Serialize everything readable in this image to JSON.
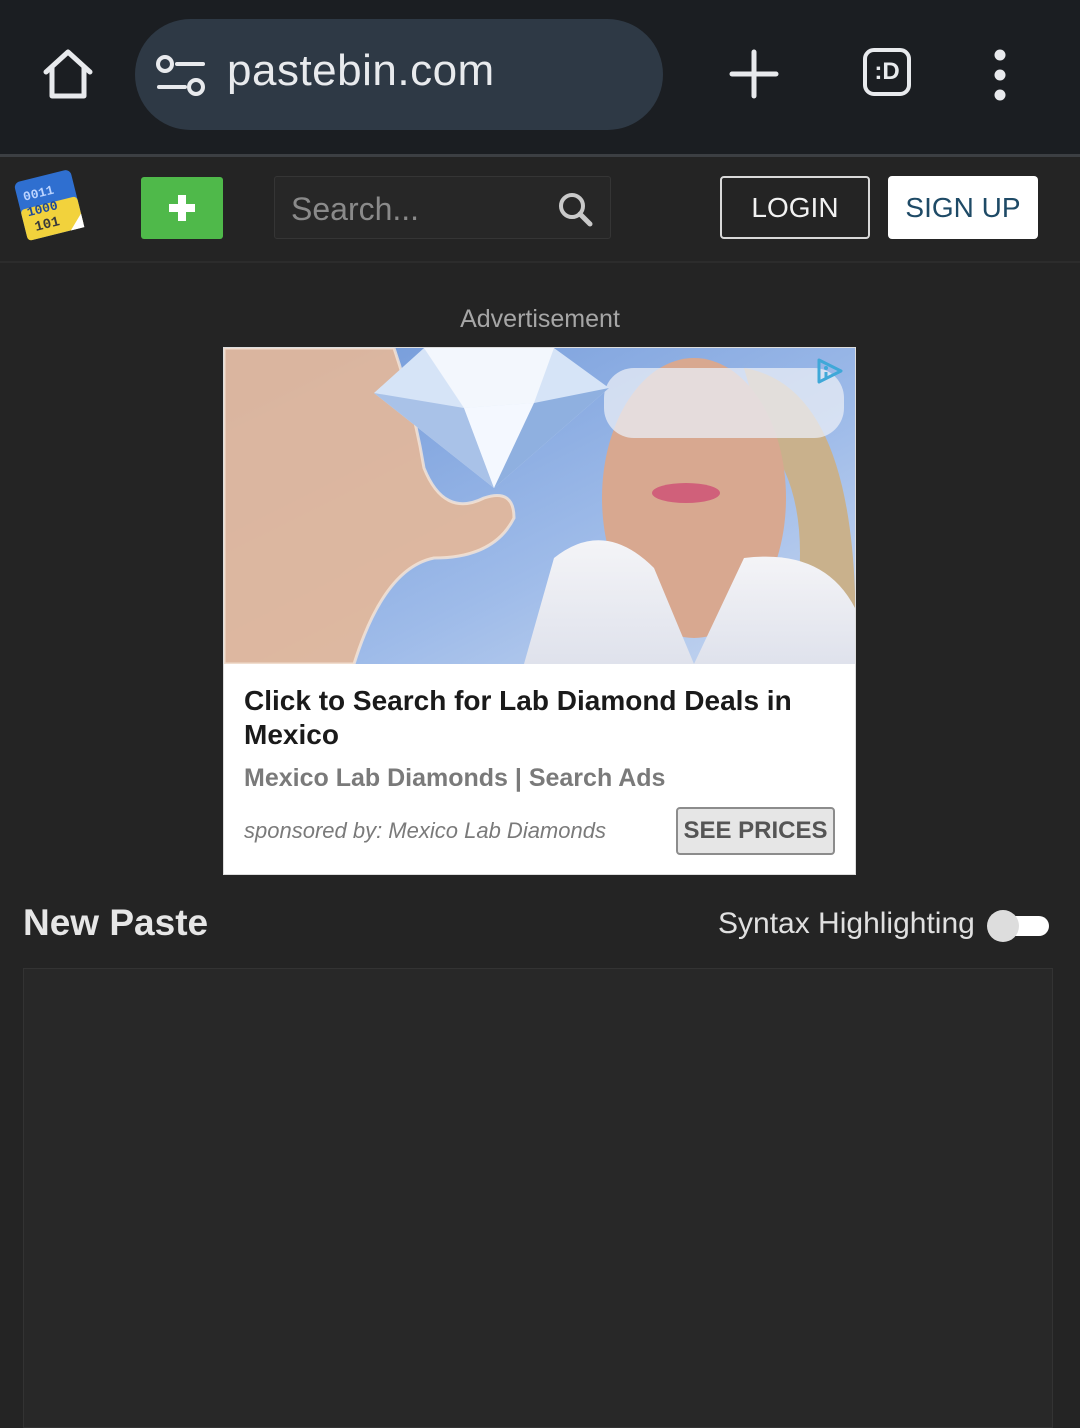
{
  "browser": {
    "url": "pastebin.com",
    "tab_switcher_label": ":D"
  },
  "header": {
    "search_placeholder": "Search...",
    "login_label": "LOGIN",
    "signup_label": "SIGN UP"
  },
  "ad": {
    "label": "Advertisement",
    "headline": "Click to Search for Lab Diamond Deals in Mexico",
    "advertiser": "Mexico Lab Diamonds | Search Ads",
    "sponsor": "sponsored by: Mexico Lab Diamonds",
    "cta_label": "SEE PRICES"
  },
  "paste": {
    "title": "New Paste",
    "syntax_label": "Syntax Highlighting",
    "syntax_enabled": false,
    "content": ""
  },
  "colors": {
    "accent_green": "#4fb94a",
    "page_background": "#242424",
    "browser_bar": "#1b1e22",
    "url_pill": "#2e3945"
  }
}
